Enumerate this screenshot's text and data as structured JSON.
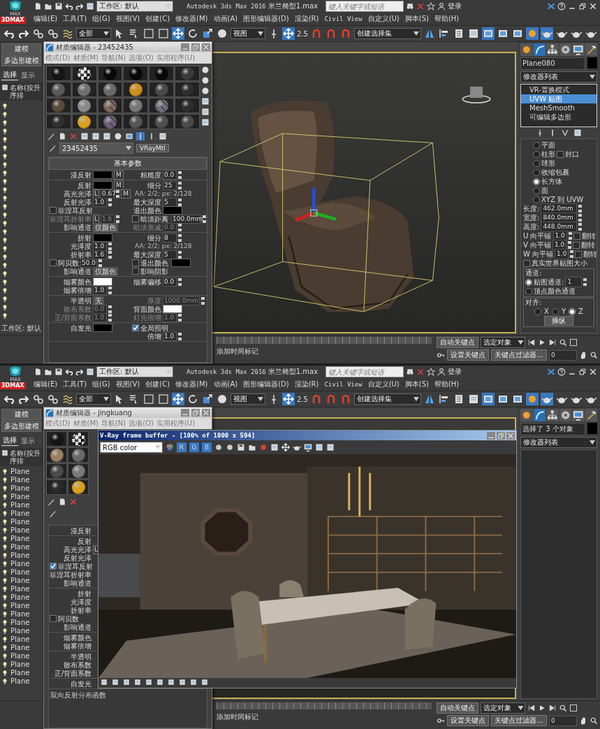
{
  "screens": [
    {
      "app_badge": "3DMAX",
      "logo_label": "MAX",
      "workspace": "工作区: 默认",
      "title": "Autodesk 3ds Max 2016",
      "file": "米兰椅型1.max",
      "search": {
        "placeholder": "键入关键字或短语"
      },
      "login": "登录",
      "menus": [
        "编辑(E)",
        "工具(T)",
        "组(G)",
        "视图(V)",
        "创建(C)",
        "修改器(M)",
        "动画(A)",
        "图形编辑器(D)",
        "渲染(R)",
        "Civil View",
        "自定义(U)",
        "脚本(S)",
        "帮助(H)"
      ],
      "toolbar": {
        "filter": "全部",
        "ref_coord": "视图",
        "snap": "2.5",
        "selection_set": "创建选择集"
      },
      "explorer": {
        "ribbon": [
          "建模",
          "多边形建模"
        ],
        "tabs": [
          {
            "label": "选择",
            "selected": true
          },
          {
            "label": "显示",
            "selected": false
          }
        ],
        "header": "名称(按升序排",
        "footer": "工作区: 默认"
      },
      "material_editor": {
        "title": "材质编辑器 - 23452435",
        "menus": [
          "模式(D)",
          "材质(M)",
          "导航(N)",
          "选项(O)",
          "实用程序(U)"
        ],
        "slots": [
          {
            "kind": "sphere",
            "color": "#151515"
          },
          {
            "kind": "checker",
            "color": "#dddddd"
          },
          {
            "kind": "sphere",
            "color": "#080808"
          },
          {
            "kind": "sphere",
            "color": "#080808"
          },
          {
            "kind": "sphere",
            "color": "#080808"
          },
          {
            "kind": "sphere",
            "color": "#3a3a3a"
          },
          {
            "kind": "sphere",
            "color": "#5a5a5a"
          },
          {
            "kind": "sphere",
            "color": "#707070"
          },
          {
            "kind": "sphere",
            "color": "#6a6a6a"
          },
          {
            "kind": "sphere",
            "color": "#d18e1c"
          },
          {
            "kind": "sphere",
            "color": "#4a4a4a"
          },
          {
            "kind": "sphere",
            "color": "#2e2e2e"
          },
          {
            "kind": "sphere",
            "color": "#5c4a3a"
          },
          {
            "kind": "sphere",
            "color": "#8a8a8a"
          },
          {
            "kind": "noise",
            "color": "#7a6a5a"
          },
          {
            "kind": "sphere",
            "color": "#777777"
          },
          {
            "kind": "noise",
            "color": "#6a7080"
          },
          {
            "kind": "sphere",
            "color": "#2e2e2e"
          },
          {
            "kind": "sphere",
            "color": "#303030"
          },
          {
            "kind": "sphere",
            "color": "#d9a020"
          },
          {
            "kind": "noise",
            "color": "#6a6080"
          },
          {
            "kind": "sphere",
            "color": "#555555"
          },
          {
            "kind": "sphere",
            "color": "#505050"
          },
          {
            "kind": "sphere",
            "color": "#4a4a4a"
          }
        ],
        "material_name": "23452435",
        "material_type": "VRayMtl",
        "rollout": "基本参数",
        "sections": [
          {
            "left": [
              {
                "kind": "color",
                "label": "漫反射",
                "color": "#000000",
                "map": "M"
              }
            ],
            "right": [
              {
                "kind": "spin",
                "label": "粗糙度",
                "value": "0.0"
              }
            ]
          },
          {
            "left": [
              {
                "kind": "color",
                "label": "反射",
                "color": "#000000",
                "map": "M"
              },
              {
                "kind": "spin",
                "label": "高光光泽",
                "lock": "L",
                "value": "0.67",
                "map": "M"
              },
              {
                "kind": "spin",
                "label": "反射光泽",
                "value": "1.0"
              },
              {
                "kind": "check",
                "label": "菲涅耳反射",
                "checked": false
              },
              {
                "kind": "spin",
                "label": "菲涅耳折射率",
                "lock": "L",
                "value": "1.6",
                "disabled": true
              },
              {
                "kind": "drop",
                "label": "影响通道",
                "value": "仅颜色"
              }
            ],
            "right": [
              {
                "kind": "spin",
                "label": "细分",
                "value": "25"
              },
              {
                "kind": "note",
                "text": "AA: 2/2; px: 2/128"
              },
              {
                "kind": "spin",
                "label": "最大深度",
                "value": "5"
              },
              {
                "kind": "color",
                "label": "退出颜色",
                "color": "#000000"
              },
              {
                "kind": "check",
                "label": "暗淡距离",
                "checked": false,
                "value": "100.0mm"
              },
              {
                "kind": "spin",
                "label": "暗淡衰减",
                "value": "0.0",
                "disabled": true
              }
            ]
          },
          {
            "left": [
              {
                "kind": "color",
                "label": "折射",
                "color": "#000000"
              },
              {
                "kind": "spin",
                "label": "光泽度",
                "value": "1.0"
              },
              {
                "kind": "spin",
                "label": "折射率",
                "value": "1.6"
              },
              {
                "kind": "check",
                "label": "阿贝数",
                "checked": false,
                "value": "50.0"
              },
              {
                "kind": "drop",
                "label": "影响通道",
                "value": "仅颜色"
              }
            ],
            "right": [
              {
                "kind": "spin",
                "label": "细分",
                "value": "8"
              },
              {
                "kind": "note",
                "text": "AA: 2/2; px: 2/128"
              },
              {
                "kind": "spin",
                "label": "最大深度",
                "value": "5"
              },
              {
                "kind": "check",
                "label": "退出颜色",
                "checked": false,
                "color": "#000000"
              },
              {
                "kind": "check",
                "label": "影响阴影",
                "checked": false
              }
            ]
          },
          {
            "left": [
              {
                "kind": "color",
                "label": "烟雾颜色",
                "color": "#ffffff"
              },
              {
                "kind": "spin",
                "label": "烟雾倍增",
                "value": "1.0"
              }
            ],
            "right": [
              {
                "kind": "spin",
                "label": "烟雾偏移",
                "value": "0.0"
              }
            ]
          },
          {
            "left": [
              {
                "kind": "drop",
                "label": "半透明",
                "value": "无"
              },
              {
                "kind": "spin",
                "label": "散布系数",
                "value": "0.0",
                "disabled": true
              },
              {
                "kind": "spin",
                "label": "正/背面系数",
                "value": "1.0",
                "disabled": true
              }
            ],
            "right": [
              {
                "kind": "spin",
                "label": "厚度",
                "value": "1000.0mm",
                "disabled": true
              },
              {
                "kind": "color",
                "label": "背面颜色",
                "color": "#ffffff"
              },
              {
                "kind": "spin",
                "label": "灯光倍增",
                "value": "1.0",
                "disabled": true
              }
            ]
          },
          {
            "left": [
              {
                "kind": "color",
                "label": "自发光",
                "color": "#000000"
              }
            ],
            "right": [
              {
                "kind": "check",
                "label": "全局照明",
                "checked": true
              },
              {
                "kind": "spin",
                "label": "倍增",
                "value": "1.0"
              }
            ]
          }
        ]
      },
      "viewport": {
        "kind": "chair"
      },
      "command_panel": {
        "object_name": "Plane080",
        "modifier_list": "修改器列表",
        "stack": [
          {
            "label": "VR-置换模式",
            "selected": false
          },
          {
            "label": "UVW 贴图",
            "selected": true
          },
          {
            "label": "MeshSmooth",
            "selected": false
          },
          {
            "label": "可编辑多边形",
            "selected": false
          }
        ],
        "mapping": [
          {
            "label": "平面",
            "selected": false
          },
          {
            "label": "柱形",
            "selected": false
          },
          {
            "label": "球形",
            "selected": false
          },
          {
            "label": "收缩包裹",
            "selected": false
          },
          {
            "label": "长方体",
            "selected": true
          },
          {
            "label": "面",
            "selected": false
          },
          {
            "label": "XYZ 到 UVW",
            "selected": false
          }
        ],
        "cap": {
          "label": "封口",
          "checked": false
        },
        "dims": [
          {
            "label": "长度:",
            "value": "462.0mm"
          },
          {
            "label": "宽度:",
            "value": "840.0mm"
          },
          {
            "label": "高度:",
            "value": "448.0mm"
          }
        ],
        "tiles": [
          {
            "label": "U 向平铺",
            "value": "1.0",
            "flip": "翻转",
            "checked": false
          },
          {
            "label": "V 向平铺",
            "value": "1.0",
            "flip": "翻转",
            "checked": false
          },
          {
            "label": "W 向平铺",
            "value": "1.0",
            "flip": "翻转",
            "checked": false
          }
        ],
        "real_world": {
          "label": "真实世界贴图大小",
          "checked": false
        },
        "channel": {
          "title": "通道:",
          "options": [
            {
              "label": "贴图通道:",
              "selected": true
            },
            {
              "label": "顶点颜色通道",
              "selected": false
            }
          ],
          "value": "1"
        },
        "align": {
          "title": "对齐:",
          "axes": [
            {
              "label": "X",
              "selected": false
            },
            {
              "label": "Y",
              "selected": false
            },
            {
              "label": "Z",
              "selected": true
            }
          ],
          "button": "操纵"
        }
      },
      "timeline": {
        "time_tag": "添加时间标记",
        "auto_key": "自动关键点",
        "key_mode": "选定对象",
        "set_key": "设置关键点",
        "key_filters": "关键点过滤器...",
        "frame": "0"
      }
    },
    {
      "app_badge": "3DMAX",
      "logo_label": "MAX",
      "workspace": "工作区: 默认",
      "title": "Autodesk 3ds Max 2016",
      "file": "米兰椅型1.max",
      "search": {
        "placeholder": "键入关键字或短语"
      },
      "login": "登录",
      "menus": [
        "编辑(E)",
        "工具(T)",
        "组(G)",
        "视图(V)",
        "创建(C)",
        "修改器(M)",
        "动画(A)",
        "图形编辑器(D)",
        "渲染(R)",
        "Civil View",
        "自定义(U)",
        "脚本(S)",
        "帮助(H)"
      ],
      "toolbar": {
        "filter": "全部",
        "ref_coord": "视图",
        "snap": "2.5",
        "selection_set": "创建选择集"
      },
      "explorer": {
        "ribbon": [
          "建模",
          "多边形建模"
        ],
        "tabs": [
          {
            "label": "选择",
            "selected": true
          },
          {
            "label": "显示",
            "selected": false
          }
        ],
        "header": "名称(按升序排",
        "items": [
          "Plane",
          "Plane",
          "Plane",
          "Plane",
          "Plane",
          "Plane",
          "Plane",
          "Plane",
          "Plane",
          "Plane",
          "Plane",
          "Plane",
          "Plane",
          "Plane",
          "Plane",
          "Plane",
          "Plane",
          "Plane",
          "Plane",
          "Plane",
          "Plane",
          "Plane",
          "Plane",
          "Plane",
          "Plane",
          "Plane"
        ]
      },
      "material_editor": {
        "title": "材质编辑器 - jingkuang",
        "menus": [
          "模式(D)",
          "材质(M)",
          "导航(N)",
          "选项(O)",
          "实用程序(U)"
        ],
        "slots": [
          {
            "kind": "sphere",
            "color": "#151515"
          },
          {
            "kind": "checker",
            "color": "#dddddd"
          },
          {
            "kind": "sphere",
            "color": "#9a8060"
          },
          {
            "kind": "sphere",
            "color": "#6a6a6a"
          },
          {
            "kind": "sphere",
            "color": "#4a4a4a"
          },
          {
            "kind": "sphere",
            "color": "#7a7a7a"
          },
          {
            "kind": "sphere",
            "color": "#2a2a2a"
          },
          {
            "kind": "sphere",
            "color": "#d9a020"
          }
        ],
        "sections": [
          {
            "left": [
              {
                "kind": "color",
                "label": "漫反射"
              }
            ]
          },
          {
            "left": [
              {
                "kind": "color",
                "label": "反射"
              },
              {
                "kind": "spin",
                "label": "高光光泽",
                "lock": "L"
              },
              {
                "kind": "spin",
                "label": "反射光泽"
              },
              {
                "kind": "check",
                "label": "菲涅耳反射",
                "checked": true
              },
              {
                "kind": "spin",
                "label": "菲涅耳折射率"
              },
              {
                "kind": "drop",
                "label": "影响通道"
              }
            ]
          },
          {
            "left": [
              {
                "kind": "color",
                "label": "折射"
              },
              {
                "kind": "spin",
                "label": "光泽度"
              },
              {
                "kind": "spin",
                "label": "折射率"
              },
              {
                "kind": "check",
                "label": "阿贝数",
                "checked": false
              },
              {
                "kind": "drop",
                "label": "影响通道"
              }
            ]
          },
          {
            "left": [
              {
                "kind": "color",
                "label": "烟雾颜色"
              },
              {
                "kind": "spin",
                "label": "烟雾倍增"
              }
            ]
          },
          {
            "left": [
              {
                "kind": "drop",
                "label": "半透明"
              },
              {
                "kind": "spin",
                "label": "散布系数"
              },
              {
                "kind": "spin",
                "label": "正/背面系数"
              }
            ]
          },
          {
            "left": [
              {
                "kind": "color",
                "label": "自发光"
              }
            ]
          }
        ],
        "footer": "双向反射分布函数"
      },
      "viewport": {
        "kind": "scene"
      },
      "frame_buffer": {
        "title": "V-Ray frame buffer - [100% of 1000 x 594]",
        "channel": "RGB color",
        "channel_buttons": [
          "R",
          "G",
          "B"
        ]
      },
      "command_panel": {
        "object_name": "选择了 3 个对象",
        "modifier_list": "修改器列表"
      },
      "timeline": {
        "time_tag": "添加时间标记",
        "auto_key": "自动关键点",
        "key_mode": "选定对象",
        "set_key": "设置关键点",
        "key_filters": "关键点过滤器...",
        "frame": "0"
      }
    }
  ]
}
